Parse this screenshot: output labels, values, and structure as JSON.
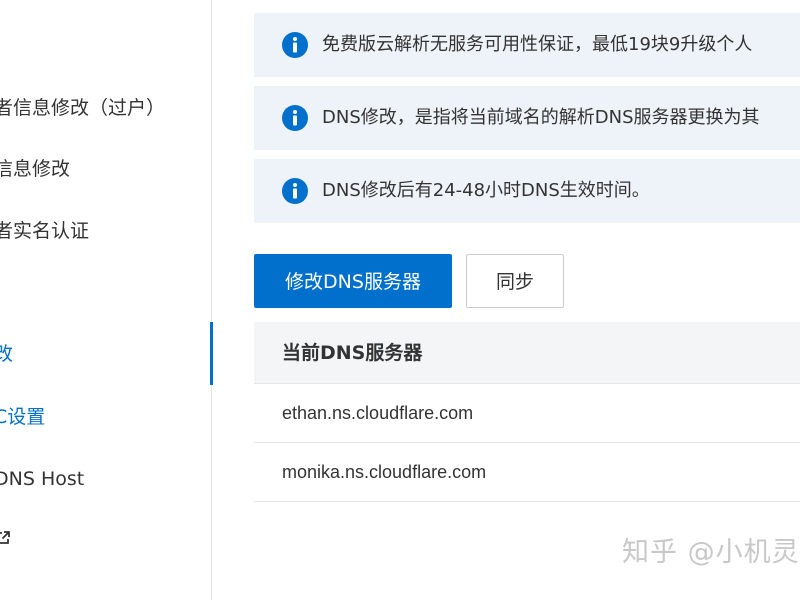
{
  "sidebar": {
    "items": [
      {
        "label": "者信息修改（过户）"
      },
      {
        "label": "信息修改"
      },
      {
        "label": "者实名认证"
      },
      {
        "label": "改"
      },
      {
        "label": "C设置"
      },
      {
        "label": "DNS Host"
      }
    ],
    "active_index": 3
  },
  "notices": [
    {
      "text": "免费版云解析无服务可用性保证，最低19块9升级个人"
    },
    {
      "text": "DNS修改，是指将当前域名的解析DNS服务器更换为其"
    },
    {
      "text": "DNS修改后有24-48小时DNS生效时间。"
    }
  ],
  "buttons": {
    "modify_dns": "修改DNS服务器",
    "sync": "同步"
  },
  "dns_table": {
    "header": "当前DNS服务器",
    "rows": [
      "ethan.ns.cloudflare.com",
      "monika.ns.cloudflare.com"
    ]
  },
  "watermark": "知乎 @小机灵",
  "colors": {
    "accent": "#0070cc",
    "notice_bg": "#eef3f9",
    "header_bg": "#f3f5f7"
  },
  "icons": {
    "notice": "info-icon",
    "external": "external-link-icon"
  }
}
